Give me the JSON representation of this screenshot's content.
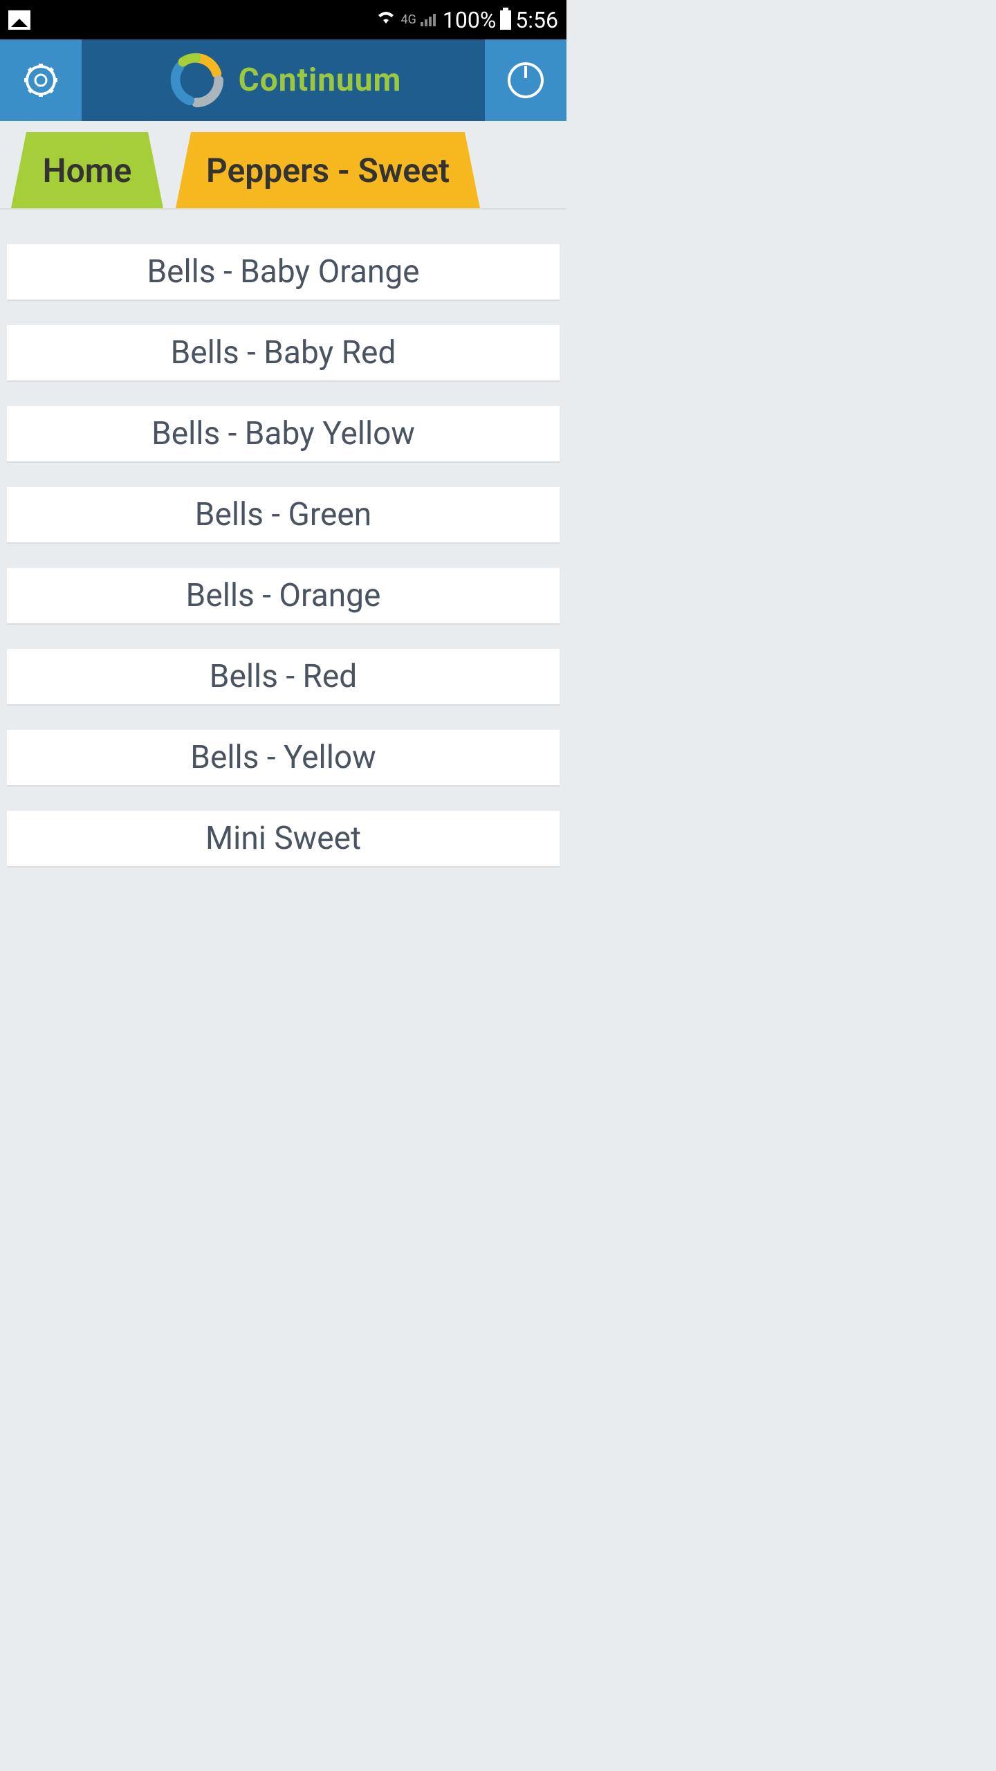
{
  "status_bar": {
    "network_label": "4G",
    "battery_percent": "100%",
    "time": "5:56"
  },
  "header": {
    "app_name": "Continuum"
  },
  "tabs": {
    "home_label": "Home",
    "category_label": "Peppers - Sweet"
  },
  "list_items": [
    "Bells - Baby Orange",
    "Bells - Baby Red",
    "Bells - Baby Yellow",
    "Bells - Green",
    "Bells - Orange",
    "Bells - Red",
    "Bells - Yellow",
    "Mini Sweet"
  ]
}
